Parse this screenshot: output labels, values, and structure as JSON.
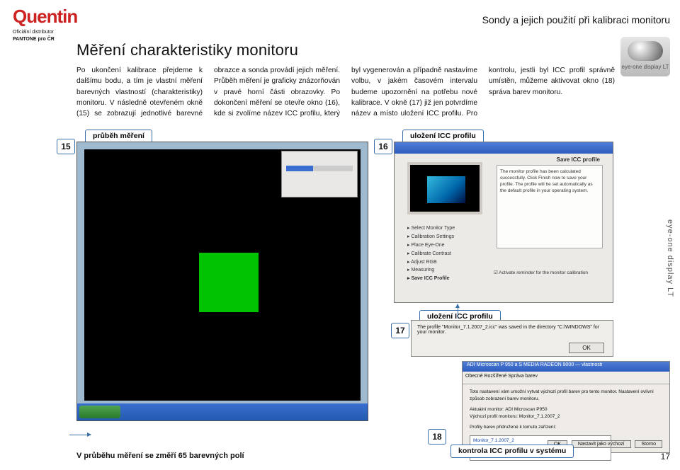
{
  "logo": {
    "brand": "Quentin",
    "sub1": "Oficiální distributor",
    "sub2": "PANTONE pro ČR"
  },
  "header": {
    "topic": "Sondy a jejich použití při kalibraci monitoru",
    "swatch": "eye-one display LT"
  },
  "title": "Měření charakteristiky monitoru",
  "body": "Po ukončení kalibrace přejdeme k dalšímu bodu, a tím je vlastní měření barevných vlastností (charakteristiky) monitoru. V následně otevřeném okně (15) se zobrazují jednotlivé barevné obrazce a sonda provádí jejich měření. Průběh měření je graficky znázorňován v pravé horní části obrazovky. Po dokončení měření se otevře okno (16), kde si zvolíme název ICC profilu, který byl vygenerován a případně nastavíme volbu, v jakém časovém intervalu budeme upozornění na potřebu nové kalibrace. V okně (17) již jen potvrdíme název a místo uložení ICC profilu. Pro kontrolu, jestli byl ICC profil správně umístěn, můžeme aktivovat okno (18) správa barev monitoru.",
  "callouts": {
    "c15": "průběh měření",
    "c16": "uložení ICC profilu",
    "c17": "uložení ICC profilu",
    "c18": "kontrola ICC profilu v systému"
  },
  "nums": {
    "n15": "15",
    "n16": "16",
    "n17": "17",
    "n18": "18"
  },
  "shot16": {
    "title": "Save ICC profile",
    "steps": [
      "Select Monitor Type",
      "Calibration Settings",
      "Place Eye-One",
      "Calibrate Contrast",
      "Adjust RGB",
      "Measuring",
      "Save ICC Profile"
    ],
    "rbox": "The monitor profile has been calculated successfully. Click Finish now to save your profile. The profile will be set automatically as the default profile in your operating system.",
    "chk": "Activate reminder for the monitor calibration"
  },
  "shot17": {
    "msg": "The profile \"Monitor_7.1.2007_2.icc\" was saved in the directory \"C:\\WINDOWS\" for your monitor.",
    "ok": "OK"
  },
  "shot18": {
    "tabs": "Obecné  Rozšířené  Správa barev",
    "hint": "Toto nastavení vám umožní vytvat výchozí profil barev pro tento monitor. Nastavení ovlivní způsob zobrazení barev monitoru.",
    "l1": "Aktuální monitor:  ADI Microscan P950",
    "l2": "Výchozí profil monitoru:  Monitor_7.1.2007_2",
    "list_label": "Profily barev přidružené k tomuto zařízení:",
    "list_item": "Monitor_7.1.2007_2",
    "btns": [
      "OK",
      "Nastavit jako výchozí",
      "Storno"
    ],
    "header": "ADI Microscan P 950 a S MEDIA RADEON 9000 — vlastnosti"
  },
  "footer": {
    "left": "V průběhu měření se změří 65 barevných polí"
  },
  "page": "17",
  "side": "eye-one display LT"
}
